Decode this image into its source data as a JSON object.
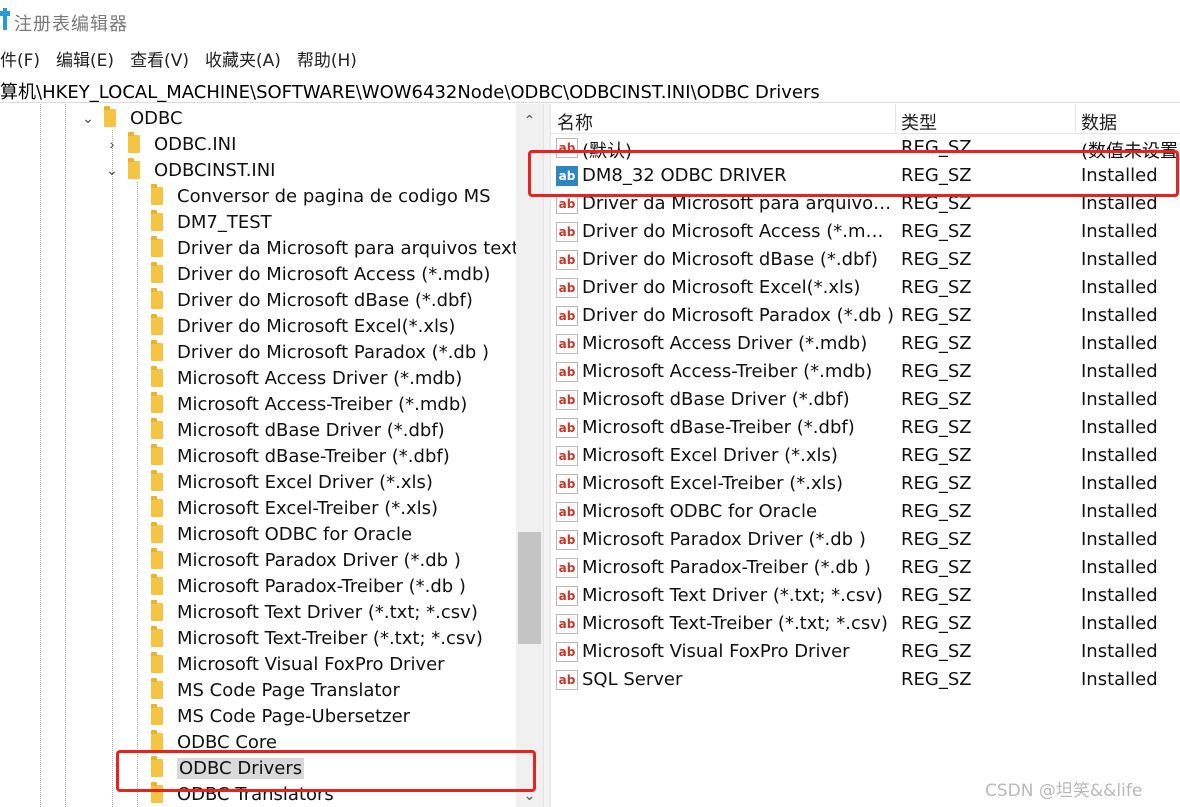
{
  "window": {
    "title": "注册表编辑器",
    "icon": "registry-icon"
  },
  "menu": [
    "件(F)",
    "编辑(E)",
    "查看(V)",
    "收藏夹(A)",
    "帮助(H)"
  ],
  "address": "算机\\HKEY_LOCAL_MACHINE\\SOFTWARE\\WOW6432Node\\ODBC\\ODBCINST.INI\\ODBC Drivers",
  "tree": {
    "odbc": "ODBC",
    "odbc_ini": "ODBC.INI",
    "odbcinst_ini": "ODBCINST.INI",
    "children": [
      "Conversor de pagina de codigo MS",
      "DM7_TEST",
      "Driver da Microsoft para arquivos texto",
      "Driver do Microsoft Access (*.mdb)",
      "Driver do Microsoft dBase (*.dbf)",
      "Driver do Microsoft Excel(*.xls)",
      "Driver do Microsoft Paradox (*.db )",
      "Microsoft Access Driver (*.mdb)",
      "Microsoft Access-Treiber (*.mdb)",
      "Microsoft dBase Driver (*.dbf)",
      "Microsoft dBase-Treiber (*.dbf)",
      "Microsoft Excel Driver (*.xls)",
      "Microsoft Excel-Treiber (*.xls)",
      "Microsoft ODBC for Oracle",
      "Microsoft Paradox Driver (*.db )",
      "Microsoft Paradox-Treiber (*.db )",
      "Microsoft Text Driver (*.txt; *.csv)",
      "Microsoft Text-Treiber (*.txt; *.csv)",
      "Microsoft Visual FoxPro Driver",
      "MS Code Page Translator",
      "MS Code Page-Ubersetzer",
      "ODBC Core",
      "ODBC Drivers",
      "ODBC Translators"
    ],
    "selected": "ODBC Drivers"
  },
  "values": {
    "headers": {
      "name": "名称",
      "type": "类型",
      "data": "数据"
    },
    "rows": [
      {
        "icon": "ab",
        "name": "(默认)",
        "type": "REG_SZ",
        "data": "(数值未设置)"
      },
      {
        "icon": "ab",
        "name": "DM8_32 ODBC DRIVER",
        "type": "REG_SZ",
        "data": "Installed",
        "selected": true
      },
      {
        "icon": "ab",
        "name": "Driver da Microsoft para arquivos t...",
        "type": "REG_SZ",
        "data": "Installed"
      },
      {
        "icon": "ab",
        "name": "Driver do Microsoft Access (*.mdb)",
        "type": "REG_SZ",
        "data": "Installed"
      },
      {
        "icon": "ab",
        "name": "Driver do Microsoft dBase (*.dbf)",
        "type": "REG_SZ",
        "data": "Installed"
      },
      {
        "icon": "ab",
        "name": "Driver do Microsoft Excel(*.xls)",
        "type": "REG_SZ",
        "data": "Installed"
      },
      {
        "icon": "ab",
        "name": "Driver do Microsoft Paradox (*.db )",
        "type": "REG_SZ",
        "data": "Installed"
      },
      {
        "icon": "ab",
        "name": "Microsoft Access Driver (*.mdb)",
        "type": "REG_SZ",
        "data": "Installed"
      },
      {
        "icon": "ab",
        "name": "Microsoft Access-Treiber (*.mdb)",
        "type": "REG_SZ",
        "data": "Installed"
      },
      {
        "icon": "ab",
        "name": "Microsoft dBase Driver (*.dbf)",
        "type": "REG_SZ",
        "data": "Installed"
      },
      {
        "icon": "ab",
        "name": "Microsoft dBase-Treiber (*.dbf)",
        "type": "REG_SZ",
        "data": "Installed"
      },
      {
        "icon": "ab",
        "name": "Microsoft Excel Driver (*.xls)",
        "type": "REG_SZ",
        "data": "Installed"
      },
      {
        "icon": "ab",
        "name": "Microsoft Excel-Treiber (*.xls)",
        "type": "REG_SZ",
        "data": "Installed"
      },
      {
        "icon": "ab",
        "name": "Microsoft ODBC for Oracle",
        "type": "REG_SZ",
        "data": "Installed"
      },
      {
        "icon": "ab",
        "name": "Microsoft Paradox Driver (*.db )",
        "type": "REG_SZ",
        "data": "Installed"
      },
      {
        "icon": "ab",
        "name": "Microsoft Paradox-Treiber (*.db )",
        "type": "REG_SZ",
        "data": "Installed"
      },
      {
        "icon": "ab",
        "name": "Microsoft Text Driver (*.txt; *.csv)",
        "type": "REG_SZ",
        "data": "Installed"
      },
      {
        "icon": "ab",
        "name": "Microsoft Text-Treiber (*.txt; *.csv)",
        "type": "REG_SZ",
        "data": "Installed"
      },
      {
        "icon": "ab",
        "name": "Microsoft Visual FoxPro Driver",
        "type": "REG_SZ",
        "data": "Installed"
      },
      {
        "icon": "ab",
        "name": "SQL Server",
        "type": "REG_SZ",
        "data": "Installed"
      }
    ]
  },
  "annotation_color": "#e8231f",
  "folder_color": "#f5c443",
  "watermark": "CSDN @坦笑&&life"
}
